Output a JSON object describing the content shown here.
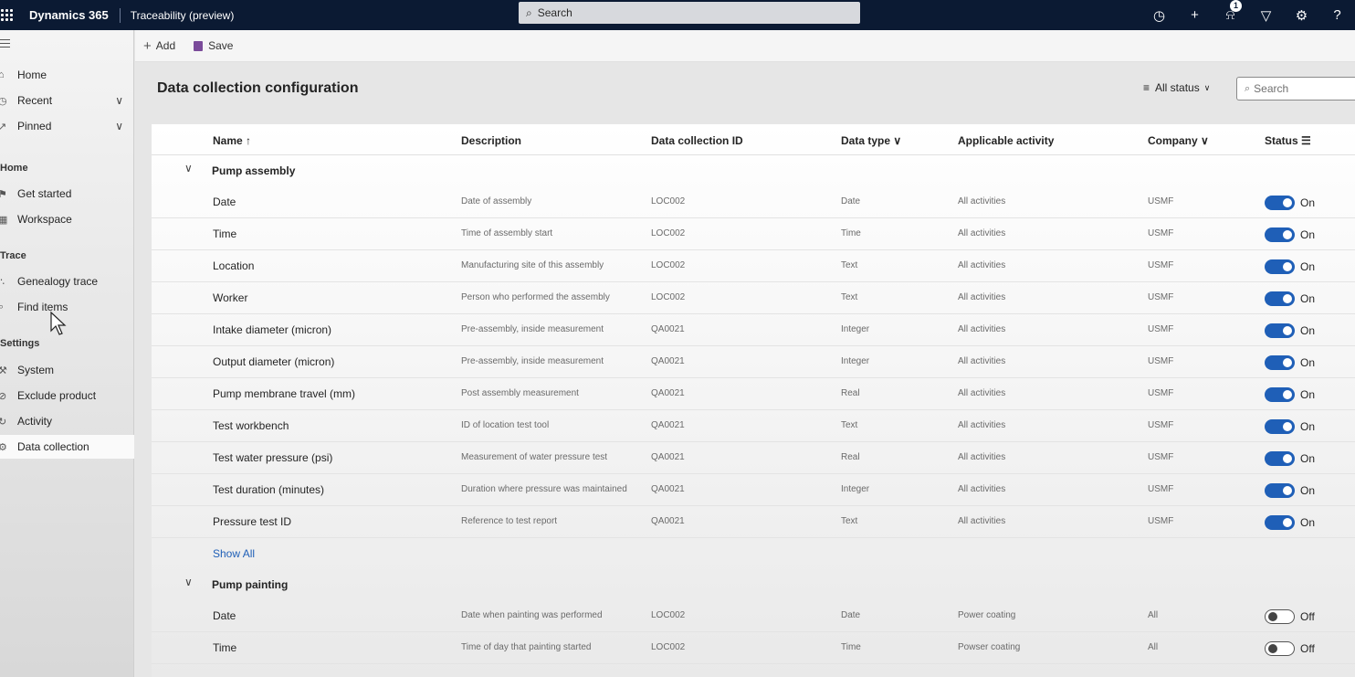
{
  "topbar": {
    "app_name": "Dynamics 365",
    "area_name": "Traceability (preview)",
    "search_placeholder": "Search",
    "notification_count": "1"
  },
  "sidebar": {
    "nav": [
      {
        "label": "Home",
        "icon": "home-icon"
      },
      {
        "label": "Recent",
        "icon": "clock-icon"
      },
      {
        "label": "Pinned",
        "icon": "pin-icon"
      }
    ],
    "sections": [
      {
        "heading": "Home",
        "items": [
          {
            "label": "Get started",
            "icon": "flag-icon"
          },
          {
            "label": "Workspace",
            "icon": "workspace-icon"
          }
        ]
      },
      {
        "heading": "Trace",
        "items": [
          {
            "label": "Genealogy trace",
            "icon": "share-icon"
          },
          {
            "label": "Find items",
            "icon": "find-icon"
          }
        ]
      },
      {
        "heading": "Settings",
        "items": [
          {
            "label": "System",
            "icon": "system-icon"
          },
          {
            "label": "Exclude product",
            "icon": "exclude-icon"
          },
          {
            "label": "Activity",
            "icon": "activity-icon"
          },
          {
            "label": "Data collection",
            "icon": "data-collection-icon"
          }
        ]
      }
    ]
  },
  "commandbar": {
    "add_label": "Add",
    "save_label": "Save"
  },
  "main": {
    "title": "Data collection configuration",
    "status_filter": "All status",
    "search_placeholder": "Search"
  },
  "grid": {
    "columns": [
      "Name",
      "Description",
      "Data collection ID",
      "Data type",
      "Applicable activity",
      "Company",
      "Status"
    ],
    "show_all_label": "Show All",
    "groups": [
      {
        "label": "Pump assembly",
        "rows": [
          {
            "name": "Date",
            "description": "Date of assembly",
            "id": "LOC002",
            "type": "Date",
            "activity": "All activities",
            "company": "USMF",
            "status": "On"
          },
          {
            "name": "Time",
            "description": "Time of assembly start",
            "id": "LOC002",
            "type": "Time",
            "activity": "All activities",
            "company": "USMF",
            "status": "On"
          },
          {
            "name": "Location",
            "description": "Manufacturing site of this assembly",
            "id": "LOC002",
            "type": "Text",
            "activity": "All activities",
            "company": "USMF",
            "status": "On"
          },
          {
            "name": "Worker",
            "description": "Person who performed the assembly",
            "id": "LOC002",
            "type": "Text",
            "activity": "All activities",
            "company": "USMF",
            "status": "On"
          },
          {
            "name": "Intake diameter (micron)",
            "description": "Pre-assembly, inside measurement",
            "id": "QA0021",
            "type": "Integer",
            "activity": "All activities",
            "company": "USMF",
            "status": "On"
          },
          {
            "name": "Output diameter (micron)",
            "description": "Pre-assembly, inside measurement",
            "id": "QA0021",
            "type": "Integer",
            "activity": "All activities",
            "company": "USMF",
            "status": "On"
          },
          {
            "name": "Pump membrane travel (mm)",
            "description": "Post assembly measurement",
            "id": "QA0021",
            "type": "Real",
            "activity": "All activities",
            "company": "USMF",
            "status": "On"
          },
          {
            "name": "Test workbench",
            "description": "ID of location test tool",
            "id": "QA0021",
            "type": "Text",
            "activity": "All activities",
            "company": "USMF",
            "status": "On"
          },
          {
            "name": "Test water pressure (psi)",
            "description": "Measurement of water pressure test",
            "id": "QA0021",
            "type": "Real",
            "activity": "All activities",
            "company": "USMF",
            "status": "On"
          },
          {
            "name": "Test duration (minutes)",
            "description": "Duration where pressure was maintained",
            "id": "QA0021",
            "type": "Integer",
            "activity": "All activities",
            "company": "USMF",
            "status": "On"
          },
          {
            "name": "Pressure test ID",
            "description": "Reference to test report",
            "id": "QA0021",
            "type": "Text",
            "activity": "All activities",
            "company": "USMF",
            "status": "On"
          }
        ]
      },
      {
        "label": "Pump painting",
        "rows": [
          {
            "name": "Date",
            "description": "Date when painting was performed",
            "id": "LOC002",
            "type": "Date",
            "activity": "Power coating",
            "company": "All",
            "status": "Off"
          },
          {
            "name": "Time",
            "description": "Time of day that painting started",
            "id": "LOC002",
            "type": "Time",
            "activity": "Powser coating",
            "company": "All",
            "status": "Off"
          }
        ]
      }
    ]
  },
  "colors": {
    "topbar": "#0b1a33",
    "accent": "#1f5fb7",
    "save_icon": "#7a4b9a"
  }
}
